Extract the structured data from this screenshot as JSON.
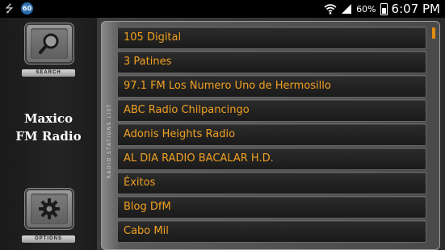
{
  "status_bar": {
    "notification_badge": "60",
    "battery_percent": "60%",
    "battery_level": 0.6,
    "time": "6:07 PM",
    "icons": [
      "usb-icon",
      "notification-badge-icon",
      "wifi-icon",
      "signal-icon",
      "battery-icon"
    ]
  },
  "sidebar": {
    "search_label": "SEARCH",
    "options_label": "OPTIONS",
    "app_title_line1": "Maxico",
    "app_title_line2": "FM Radio"
  },
  "panel": {
    "vertical_label": "RADIO STATIONS LIST"
  },
  "stations": [
    {
      "name": "105 Digital"
    },
    {
      "name": "3 Patines"
    },
    {
      "name": "97.1 FM Los Numero Uno de Hermosillo"
    },
    {
      "name": "ABC Radio Chilpancingo"
    },
    {
      "name": "Adonis Heights Radio"
    },
    {
      "name": "AL DIA RADIO BACALAR H.D."
    },
    {
      "name": "Éxitos"
    },
    {
      "name": "Blog DfM"
    },
    {
      "name": "Cabo Mil"
    }
  ],
  "colors": {
    "accent": "#f0a020",
    "scrollbar": "#e08a10"
  }
}
